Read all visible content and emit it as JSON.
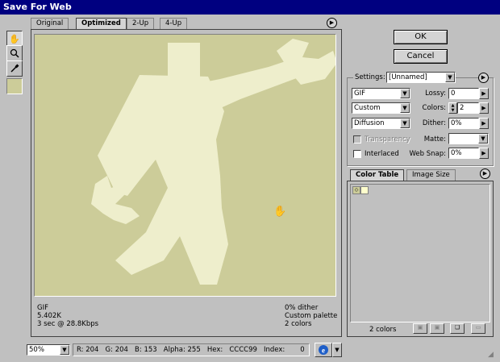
{
  "window": {
    "title": "Save For Web"
  },
  "tabs": [
    {
      "label": "Original"
    },
    {
      "label": "Optimized"
    },
    {
      "label": "2-Up"
    },
    {
      "label": "4-Up"
    }
  ],
  "tools": [
    "hand-tool",
    "zoom-tool",
    "eyedropper-tool"
  ],
  "preview": {
    "format": "GIF",
    "file_size": "5.402K",
    "download_time": "3 sec @ 28.8Kbps",
    "dither_info": "0% dither",
    "palette_info": "Custom palette",
    "colors_info": "2 colors",
    "background_color": "#cccc99",
    "figure_color": "#eeeecc"
  },
  "buttons": {
    "ok": "OK",
    "cancel": "Cancel"
  },
  "settings": {
    "label": "Settings:",
    "preset": "[Unnamed]",
    "format": "GIF",
    "palette": "Custom",
    "dither_method": "Diffusion",
    "lossy_label": "Lossy:",
    "lossy_value": "0",
    "colors_label": "Colors:",
    "colors_value": "2",
    "dither_label": "Dither:",
    "dither_value": "0%",
    "transparency_label": "Transparency",
    "matte_label": "Matte:",
    "interlaced_label": "Interlaced",
    "websnap_label": "Web Snap:",
    "websnap_value": "0%"
  },
  "color_panel": {
    "tab_color_table": "Color Table",
    "tab_image_size": "Image Size",
    "colors_count": "2 colors",
    "swatch_color": "#ffffcc"
  },
  "status": {
    "zoom": "50%",
    "r": "R: 204",
    "g": "G: 204",
    "b": "B: 153",
    "alpha": "Alpha: 255",
    "hex": "Hex:",
    "hex_value": "CCCC99",
    "index": "Index:",
    "index_value": "0"
  }
}
